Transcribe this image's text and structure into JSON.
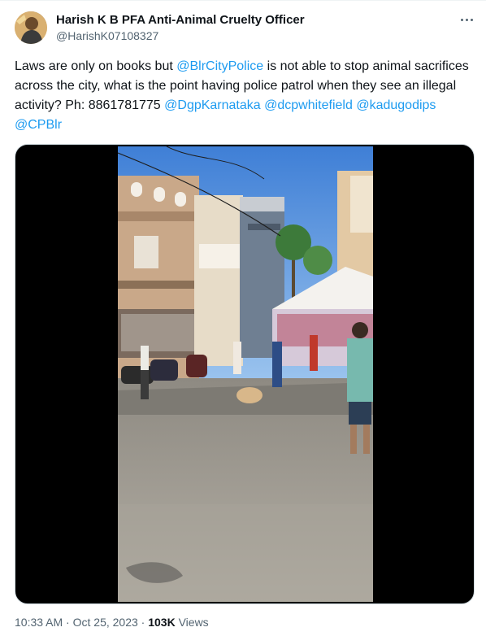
{
  "author": {
    "display_name": "Harish K B PFA Anti-Animal Cruelty Officer",
    "handle": "@HarishK07108327"
  },
  "tweet": {
    "text_parts": [
      {
        "kind": "text",
        "value": "Laws are only on books but "
      },
      {
        "kind": "mention",
        "value": "@BlrCityPolice"
      },
      {
        "kind": "text",
        "value": " is not able to stop animal sacrifices across the city, what is the point having police patrol when they see an illegal activity? Ph: 8861781775 "
      },
      {
        "kind": "mention",
        "value": "@DgpKarnataka"
      },
      {
        "kind": "text",
        "value": " "
      },
      {
        "kind": "mention",
        "value": "@dcpwhitefield"
      },
      {
        "kind": "text",
        "value": " "
      },
      {
        "kind": "mention",
        "value": "@kadugodips"
      },
      {
        "kind": "text",
        "value": " "
      },
      {
        "kind": "mention",
        "value": "@CPBlr"
      }
    ]
  },
  "footer": {
    "time": "10:33 AM",
    "separator": " · ",
    "date": "Oct 25, 2023",
    "views_count": "103K",
    "views_label": "Views"
  },
  "icons": {
    "more": "more-horizontal-icon"
  },
  "colors": {
    "mention": "#1d9bf0",
    "secondary_text": "#536471",
    "media_background": "#000000"
  }
}
